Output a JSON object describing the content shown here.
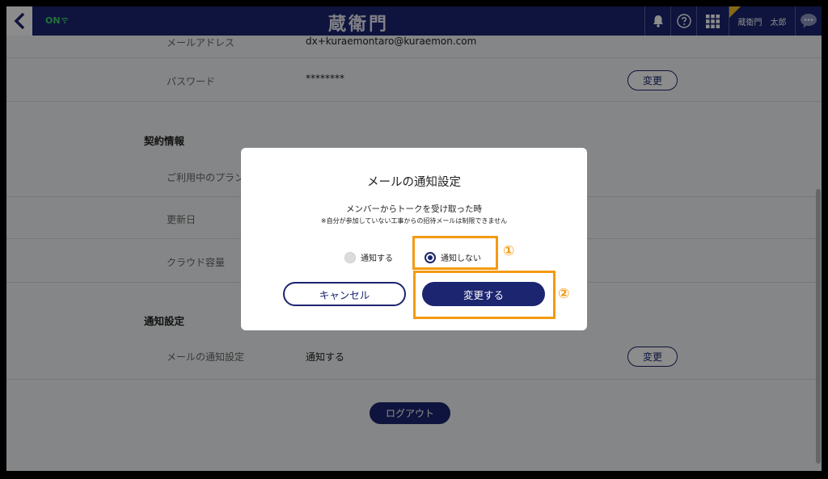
{
  "header": {
    "status": "ON",
    "logo": "蔵衛門",
    "user_name": "蔵衛門　太郎"
  },
  "account": {
    "email_label": "メールアドレス",
    "email_value": "dx+kuraemontaro@kuraemon.com",
    "password_label": "パスワード",
    "password_value": "********",
    "change_label": "変更"
  },
  "contract": {
    "section_title": "契約情報",
    "plan_label": "ご利用中のプラン",
    "renewal_label": "更新日",
    "storage_label": "クラウド容量"
  },
  "notifications": {
    "section_title": "通知設定",
    "mail_label": "メールの通知設定",
    "mail_value": "通知する",
    "change_label": "変更"
  },
  "logout_label": "ログアウト",
  "dialog": {
    "title": "メールの通知設定",
    "subtitle": "メンバーからトークを受け取った時",
    "note": "※自分が参加していない工事からの招待メールは制限できません",
    "options": [
      "通知する",
      "通知しない"
    ],
    "selected": "通知しない",
    "cancel_label": "キャンセル",
    "submit_label": "変更する"
  },
  "annotations": {
    "step1": "①",
    "step2": "②",
    "color": "#f39a12"
  },
  "colors": {
    "brand": "#1b2570",
    "status_on": "#3ecf6d"
  }
}
